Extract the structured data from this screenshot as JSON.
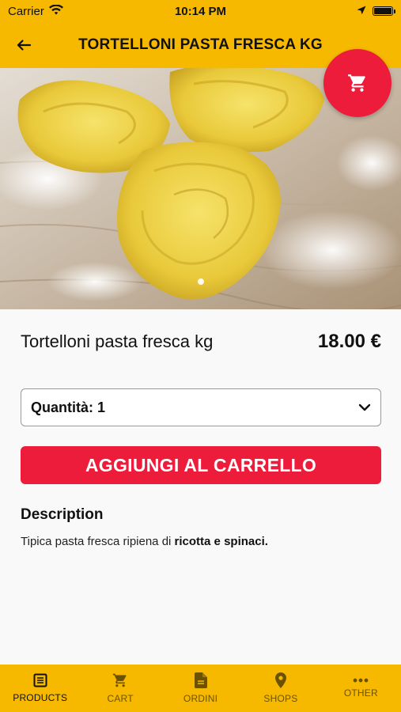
{
  "status_bar": {
    "carrier": "Carrier",
    "time": "10:14 PM"
  },
  "nav": {
    "title": "TORTELLONI PASTA FRESCA KG"
  },
  "product": {
    "name": "Tortelloni pasta fresca kg",
    "price": "18.00 €",
    "quantity_label": "Quantità: 1",
    "add_to_cart_label": "AGGIUNGI AL CARRELLO",
    "description_title": "Description",
    "description_prefix": "Tipica pasta fresca ripiena di ",
    "description_bold": "ricotta e spinaci."
  },
  "tabs": [
    {
      "label": "PRODUCTS",
      "icon": "list-icon",
      "active": true
    },
    {
      "label": "CART",
      "icon": "cart-icon",
      "active": false
    },
    {
      "label": "ORDINI",
      "icon": "document-icon",
      "active": false
    },
    {
      "label": "SHOPS",
      "icon": "location-pin-icon",
      "active": false
    },
    {
      "label": "OTHER",
      "icon": "more-dots-icon",
      "active": false
    }
  ],
  "colors": {
    "primary": "#f7b900",
    "accent": "#ee1c3b"
  }
}
